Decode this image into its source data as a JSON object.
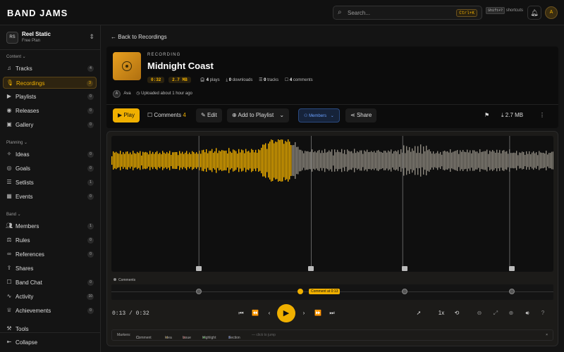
{
  "app": {
    "title": "BAND JAMS"
  },
  "search": {
    "placeholder": "Search...",
    "kbd": "Ctrl+K"
  },
  "shortcuts": {
    "key": "Shift+?",
    "label": "shortcuts"
  },
  "user": {
    "initial": "A"
  },
  "workspace": {
    "badge": "RS",
    "name": "Reel Static",
    "plan": "Free Plan"
  },
  "sidebar": {
    "sections": [
      {
        "label": "Content"
      },
      {
        "label": "Planning"
      },
      {
        "label": "Band"
      }
    ],
    "items": [
      {
        "label": "Tracks",
        "count": "4",
        "icon": "music-note-icon"
      },
      {
        "label": "Recordings",
        "count": "3",
        "icon": "mic-icon"
      },
      {
        "label": "Playlists",
        "count": "0",
        "icon": "playlist-icon"
      },
      {
        "label": "Releases",
        "count": "0",
        "icon": "disc-icon"
      },
      {
        "label": "Gallery",
        "count": "0",
        "icon": "image-icon"
      },
      {
        "label": "Ideas",
        "count": "0",
        "icon": "lightbulb-icon"
      },
      {
        "label": "Goals",
        "count": "0",
        "icon": "target-icon"
      },
      {
        "label": "Setlists",
        "count": "1",
        "icon": "list-icon"
      },
      {
        "label": "Events",
        "count": "0",
        "icon": "calendar-icon"
      },
      {
        "label": "Members",
        "count": "1",
        "icon": "users-icon"
      },
      {
        "label": "Rules",
        "count": "0",
        "icon": "book-icon"
      },
      {
        "label": "References",
        "count": "0",
        "icon": "link-icon"
      },
      {
        "label": "Shares",
        "count": "",
        "icon": "share-icon"
      },
      {
        "label": "Band Chat",
        "count": "0",
        "icon": "chat-icon"
      },
      {
        "label": "Activity",
        "count": "10",
        "icon": "activity-icon"
      },
      {
        "label": "Achievements",
        "count": "0",
        "icon": "trophy-icon"
      }
    ],
    "tools": "Tools",
    "collapse": "Collapse"
  },
  "main": {
    "back_label": "Back to Recordings",
    "kind": "RECORDING",
    "title": "Midnight Coast",
    "duration": "0:32",
    "size": "2.7 MB",
    "plays": "4",
    "plays_label": "plays",
    "downloads": "0",
    "downloads_label": "downloads",
    "tracks": "0",
    "tracks_label": "tracks",
    "comments": "4",
    "comments_label": "comments",
    "uploader_initial": "A",
    "uploader": "Ava",
    "uploaded": "Uploaded about 1 hour ago"
  },
  "actions": {
    "play": "Play",
    "comments": "Comments",
    "comments_count": "4",
    "edit": "Edit",
    "add_to_playlist": "Add to Playlist",
    "members": "Members",
    "share": "Share",
    "download_size": "2.7 MB"
  },
  "player": {
    "progress": 0.406,
    "comment_positions": [
      0.198,
      0.452,
      0.659,
      0.901
    ],
    "comments_label": "Comments",
    "active_comment": "Comment at 0:13",
    "current_time": "0:13",
    "separator": "/",
    "total_time": "0:32",
    "speed": "1x",
    "accent": "#f0b000"
  },
  "markers_bar": {
    "label": "Markers:",
    "comment": "Comment",
    "idea": "Idea",
    "issue": "Issue",
    "highlight": "Highlight",
    "section": "Section",
    "hint": "— click to jump"
  }
}
